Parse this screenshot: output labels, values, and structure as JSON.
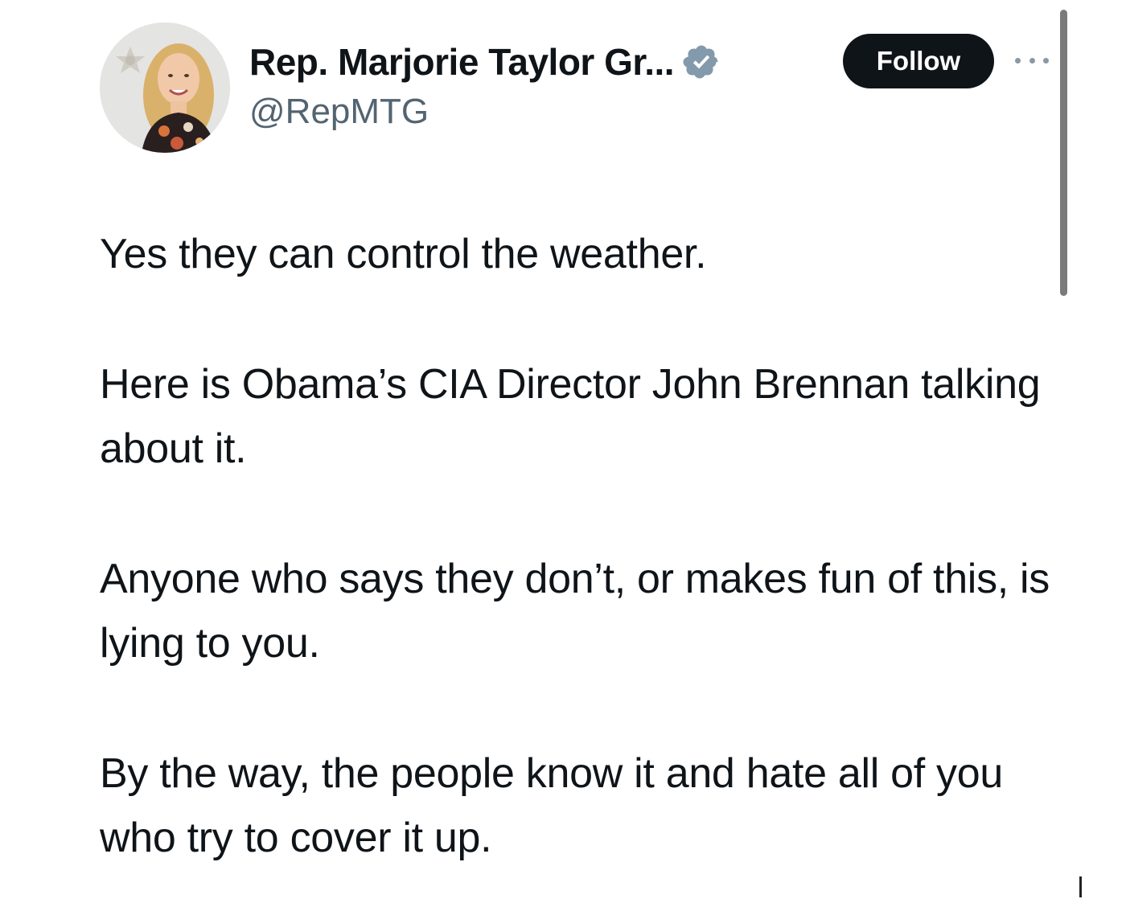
{
  "tweet": {
    "author": {
      "display_name": "Rep. Marjorie Taylor Gr...",
      "handle": "@RepMTG",
      "verified_icon": "verified-badge-icon",
      "verified_color": "#829aab"
    },
    "follow_label": "Follow",
    "more_icon": "more-options-icon",
    "paragraphs": [
      "Yes they can control the weather.",
      "Here is Obama’s CIA Director John Brennan talking about it.",
      "Anyone who says they don’t, or makes fun of this, is lying to you.",
      "By the way, the people know it and hate all of you who try to cover it up."
    ]
  },
  "colors": {
    "text_primary": "#0f1419",
    "text_secondary": "#536471",
    "button_bg": "#0f1419",
    "button_text": "#ffffff"
  }
}
